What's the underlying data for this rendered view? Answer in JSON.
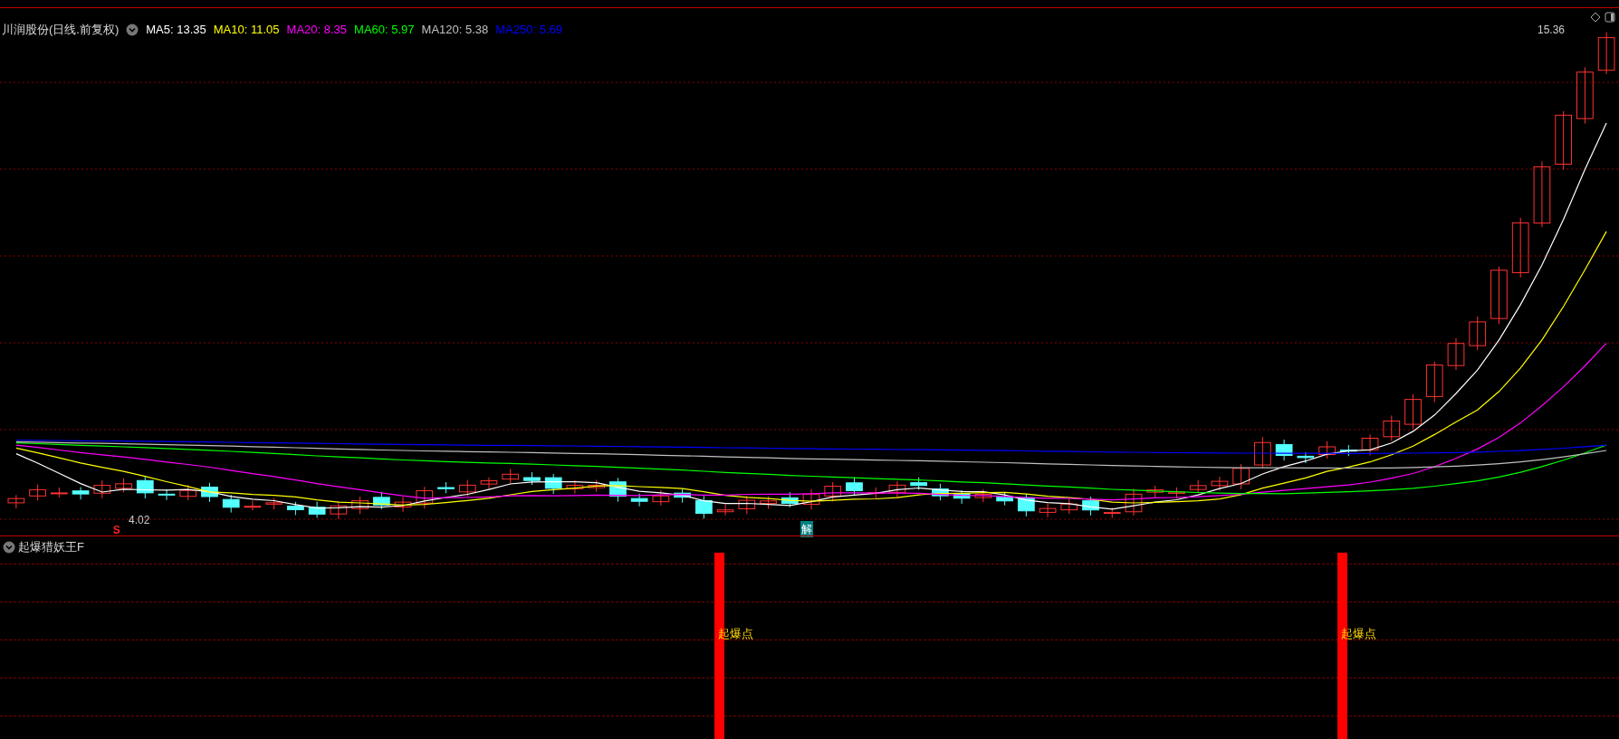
{
  "header": {
    "title": "川润股份(日线.前复权)",
    "ma": [
      {
        "label": "MA5: 13.35",
        "color": "#ffffff"
      },
      {
        "label": "MA10: 11.05",
        "color": "#ffff00"
      },
      {
        "label": "MA20: 8.35",
        "color": "#ff00ff"
      },
      {
        "label": "MA60: 5.97",
        "color": "#00ff00"
      },
      {
        "label": "MA120: 5.38",
        "color": "#c0c0c0"
      },
      {
        "label": "MA250: 5.69",
        "color": "#0000ff"
      }
    ]
  },
  "price_labels": {
    "high": "15.36",
    "low": "4.02"
  },
  "markers": [
    {
      "kind": "sell",
      "text": "S"
    },
    {
      "kind": "unlock",
      "text": "解"
    }
  ],
  "indicator": {
    "title": "起爆猎妖王F",
    "signals": [
      "起爆点",
      "起爆点"
    ]
  }
}
